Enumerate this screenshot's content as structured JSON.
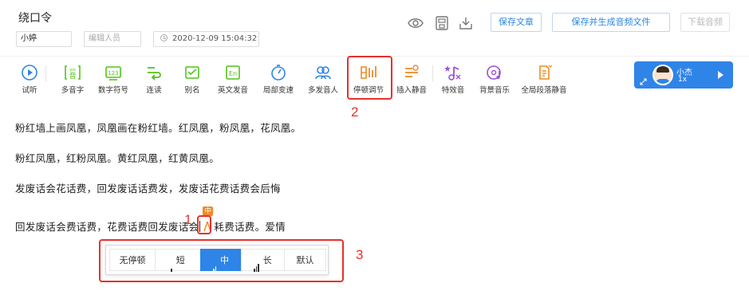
{
  "document": {
    "title": "绕口令",
    "author": "小婷",
    "editor_placeholder": "编辑人员",
    "date": "2020-12-09 15:04:32"
  },
  "header_buttons": {
    "save_article": "保存文章",
    "save_and_generate": "保存并生成音频文件",
    "download_audio": "下载音频"
  },
  "toolbar": [
    {
      "label": "试听",
      "icon": "play-circle-icon",
      "color": "#2f84e8"
    },
    {
      "label": "多音字",
      "icon": "polyphone-icon",
      "color": "#52c41a"
    },
    {
      "label": "数字符号",
      "icon": "number-symbol-icon",
      "color": "#52c41a"
    },
    {
      "label": "连读",
      "icon": "liaison-icon",
      "color": "#52c41a"
    },
    {
      "label": "别名",
      "icon": "alias-icon",
      "color": "#52c41a"
    },
    {
      "label": "英文发音",
      "icon": "english-pronounce-icon",
      "color": "#52c41a"
    },
    {
      "label": "局部变速",
      "icon": "speed-change-icon",
      "color": "#2f84e8"
    },
    {
      "label": "多发音人",
      "icon": "multi-speaker-icon",
      "color": "#2f84e8"
    },
    {
      "label": "停顿调节",
      "icon": "pause-adjust-icon",
      "color": "#f08a24"
    },
    {
      "label": "插入静音",
      "icon": "insert-silence-icon",
      "color": "#f08a24"
    },
    {
      "label": "特效音",
      "icon": "sound-effect-icon",
      "color": "#9b4fd6"
    },
    {
      "label": "背景音乐",
      "icon": "background-music-icon",
      "color": "#9b4fd6"
    },
    {
      "label": "全局段落静音",
      "icon": "global-paragraph-silence-icon",
      "color": "#f08a24"
    }
  ],
  "voice": {
    "name": "小杰",
    "speed": "1x"
  },
  "content": {
    "line1": "粉红墙上画凤凰，凤凰画在粉红墙。红凤凰，粉凤凰，花凤凰。",
    "line2": "粉红凤凰，红粉凤凰。黄红凤凰，红黄凤凰。",
    "line3": "发废话会花话费，回发废话话费发，发废话花费话费会后悔",
    "line4_before": "回发废话会费话费，花费话费回发废话会",
    "line4_after": "耗费话费。爱情",
    "pause_tag": "中"
  },
  "pause_popup": {
    "options": [
      "无停顿",
      "短",
      "中",
      "长",
      "默认"
    ],
    "selected": "中"
  },
  "annotations": [
    "1",
    "2",
    "3"
  ]
}
